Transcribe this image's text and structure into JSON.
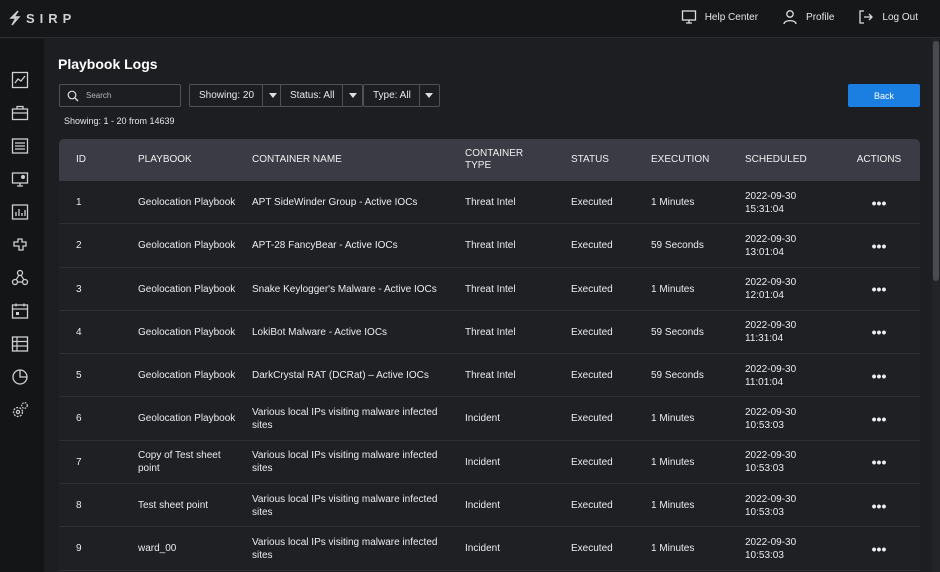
{
  "app": {
    "logo_text": "SIRP"
  },
  "topbar": {
    "help_label": "Help Center",
    "profile_label": "Profile",
    "logout_label": "Log Out"
  },
  "sidebar": {
    "items": [
      "dashboard-icon",
      "cases-icon",
      "list-icon",
      "monitor-icon",
      "reports-icon",
      "integrations-icon",
      "workflow-icon",
      "calendar-icon",
      "assets-icon",
      "analytics-icon",
      "settings-icon"
    ]
  },
  "page": {
    "title": "Playbook Logs",
    "search_placeholder": "Search",
    "filters": {
      "showing": "Showing: 20",
      "status": "Status: All",
      "type": "Type: All"
    },
    "back_label": "Back",
    "showing_count": "Showing: 1 - 20 from 14639"
  },
  "table": {
    "headers": {
      "id": "ID",
      "playbook": "PLAYBOOK",
      "container_name": "CONTAINER NAME",
      "container_type": "CONTAINER TYPE",
      "status": "STATUS",
      "execution": "EXECUTION",
      "scheduled": "SCHEDULED",
      "actions": "ACTIONS"
    },
    "rows": [
      {
        "id": "1",
        "playbook": "Geolocation Playbook",
        "container_name": "APT SideWinder Group - Active IOCs",
        "container_type": "Threat Intel",
        "status": "Executed",
        "execution": "1 Minutes",
        "scheduled": "2022-09-30 15:31:04",
        "actions": "•••"
      },
      {
        "id": "2",
        "playbook": "Geolocation Playbook",
        "container_name": "APT-28 FancyBear - Active IOCs",
        "container_type": "Threat Intel",
        "status": "Executed",
        "execution": "59 Seconds",
        "scheduled": "2022-09-30 13:01:04",
        "actions": "•••"
      },
      {
        "id": "3",
        "playbook": "Geolocation Playbook",
        "container_name": "Snake Keylogger's Malware - Active IOCs",
        "container_type": "Threat Intel",
        "status": "Executed",
        "execution": "1 Minutes",
        "scheduled": "2022-09-30 12:01:04",
        "actions": "•••"
      },
      {
        "id": "4",
        "playbook": "Geolocation Playbook",
        "container_name": "LokiBot Malware - Active IOCs",
        "container_type": "Threat Intel",
        "status": "Executed",
        "execution": "59 Seconds",
        "scheduled": "2022-09-30 11:31:04",
        "actions": "•••"
      },
      {
        "id": "5",
        "playbook": "Geolocation Playbook",
        "container_name": "DarkCrystal RAT (DCRat) – Active IOCs",
        "container_type": "Threat Intel",
        "status": "Executed",
        "execution": "59 Seconds",
        "scheduled": "2022-09-30 11:01:04",
        "actions": "•••"
      },
      {
        "id": "6",
        "playbook": "Geolocation Playbook",
        "container_name": "Various local IPs visiting malware infected sites",
        "container_type": "Incident",
        "status": "Executed",
        "execution": "1 Minutes",
        "scheduled": "2022-09-30 10:53:03",
        "actions": "•••"
      },
      {
        "id": "7",
        "playbook": "Copy of Test sheet point",
        "container_name": "Various local IPs visiting malware infected sites",
        "container_type": "Incident",
        "status": "Executed",
        "execution": "1 Minutes",
        "scheduled": "2022-09-30 10:53:03",
        "actions": "•••"
      },
      {
        "id": "8",
        "playbook": "Test sheet point",
        "container_name": "Various local IPs visiting malware infected sites",
        "container_type": "Incident",
        "status": "Executed",
        "execution": "1 Minutes",
        "scheduled": "2022-09-30 10:53:03",
        "actions": "•••"
      },
      {
        "id": "9",
        "playbook": "ward_00",
        "container_name": "Various local IPs visiting malware infected sites",
        "container_type": "Incident",
        "status": "Executed",
        "execution": "1 Minutes",
        "scheduled": "2022-09-30 10:53:03",
        "actions": "•••"
      }
    ]
  }
}
